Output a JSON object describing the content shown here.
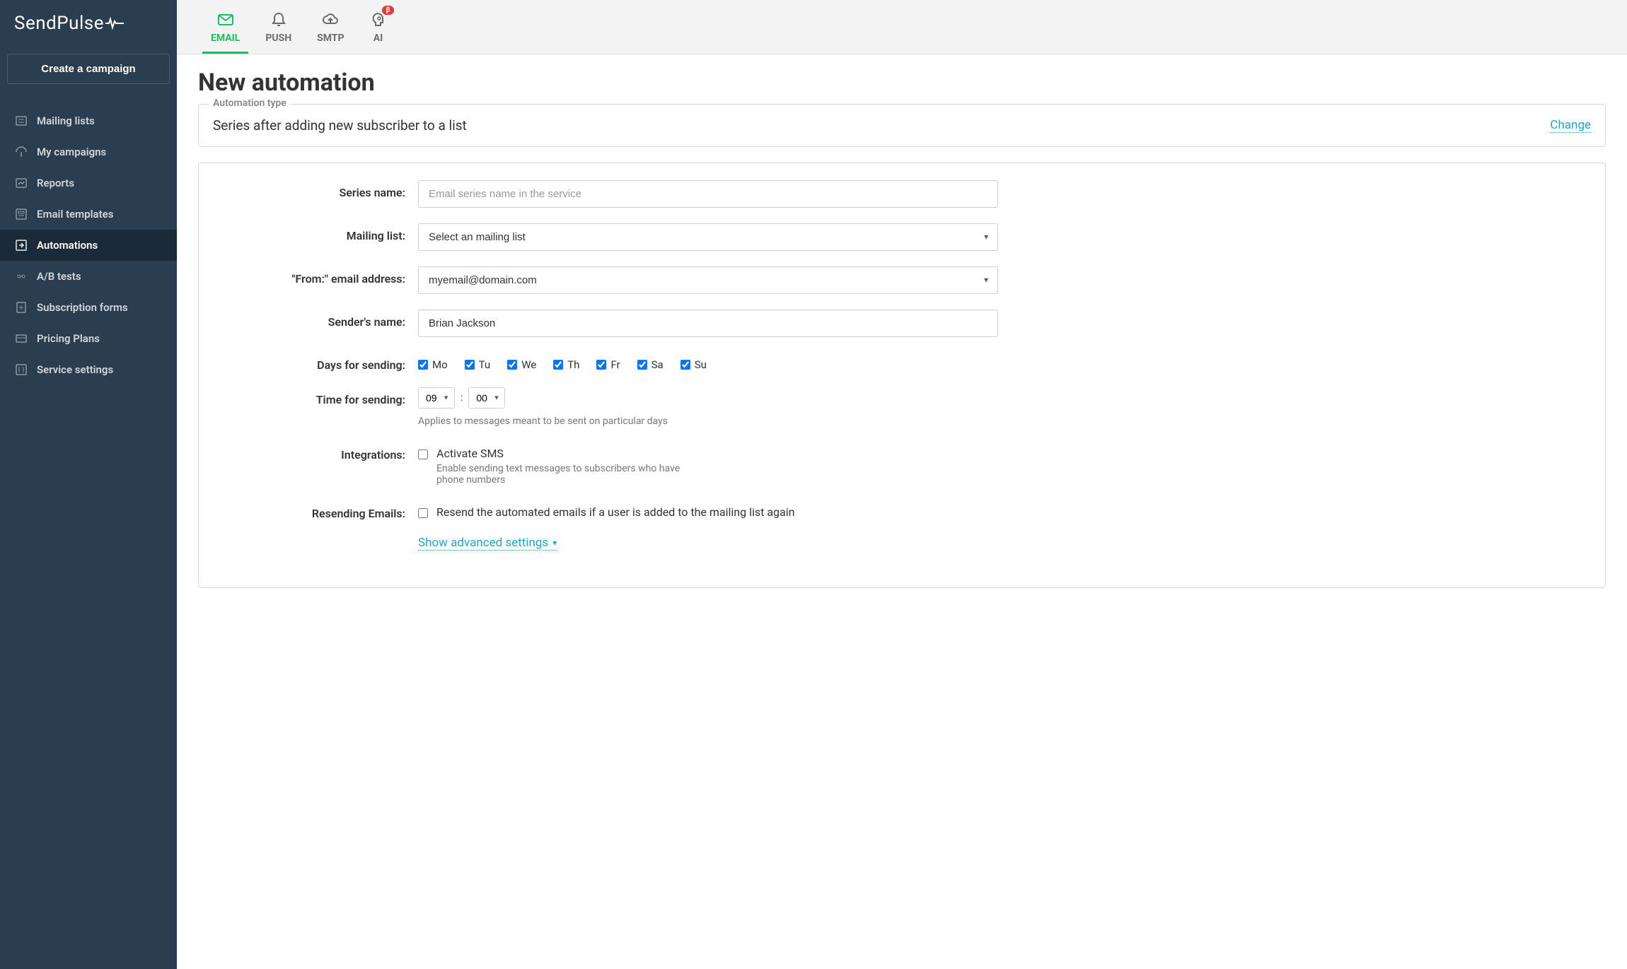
{
  "brand": "SendPulse",
  "sidebar": {
    "create_label": "Create a campaign",
    "items": [
      {
        "label": "Mailing lists",
        "icon": "list"
      },
      {
        "label": "My campaigns",
        "icon": "campaign"
      },
      {
        "label": "Reports",
        "icon": "report"
      },
      {
        "label": "Email templates",
        "icon": "template"
      },
      {
        "label": "Automations",
        "icon": "automation",
        "active": true
      },
      {
        "label": "A/B tests",
        "icon": "abtest"
      },
      {
        "label": "Subscription forms",
        "icon": "form"
      },
      {
        "label": "Pricing Plans",
        "icon": "pricing"
      },
      {
        "label": "Service settings",
        "icon": "settings"
      }
    ]
  },
  "top_tabs": [
    {
      "label": "EMAIL",
      "icon": "mail",
      "active": true
    },
    {
      "label": "PUSH",
      "icon": "bell"
    },
    {
      "label": "SMTP",
      "icon": "cloud"
    },
    {
      "label": "AI",
      "icon": "head",
      "badge": "β"
    }
  ],
  "page_title": "New automation",
  "automation_type": {
    "legend": "Automation type",
    "text": "Series after adding new subscriber to a list",
    "change_label": "Change"
  },
  "form": {
    "series_name": {
      "label": "Series name:",
      "placeholder": "Email series name in the service",
      "value": ""
    },
    "mailing_list": {
      "label": "Mailing list:",
      "selected": "Select an mailing list"
    },
    "from_email": {
      "label": "\"From:\" email address:",
      "selected": "myemail@domain.com"
    },
    "sender_name": {
      "label": "Sender's name:",
      "value": "Brian Jackson"
    },
    "days": {
      "label": "Days for sending:",
      "items": [
        {
          "short": "Mo",
          "checked": true
        },
        {
          "short": "Tu",
          "checked": true
        },
        {
          "short": "We",
          "checked": true
        },
        {
          "short": "Th",
          "checked": true
        },
        {
          "short": "Fr",
          "checked": true
        },
        {
          "short": "Sa",
          "checked": true
        },
        {
          "short": "Su",
          "checked": true
        }
      ]
    },
    "time": {
      "label": "Time for sending:",
      "hour": "09",
      "minute": "00",
      "hint": "Applies to messages meant to be sent on particular days"
    },
    "integrations": {
      "label": "Integrations:",
      "checked": false,
      "check_label": "Activate SMS",
      "check_desc": "Enable sending text messages to subscribers who have phone numbers"
    },
    "resending": {
      "label": "Resending Emails:",
      "checked": false,
      "check_label": "Resend the automated emails if a user is added to the mailing list again"
    },
    "advanced_label": "Show advanced settings"
  }
}
